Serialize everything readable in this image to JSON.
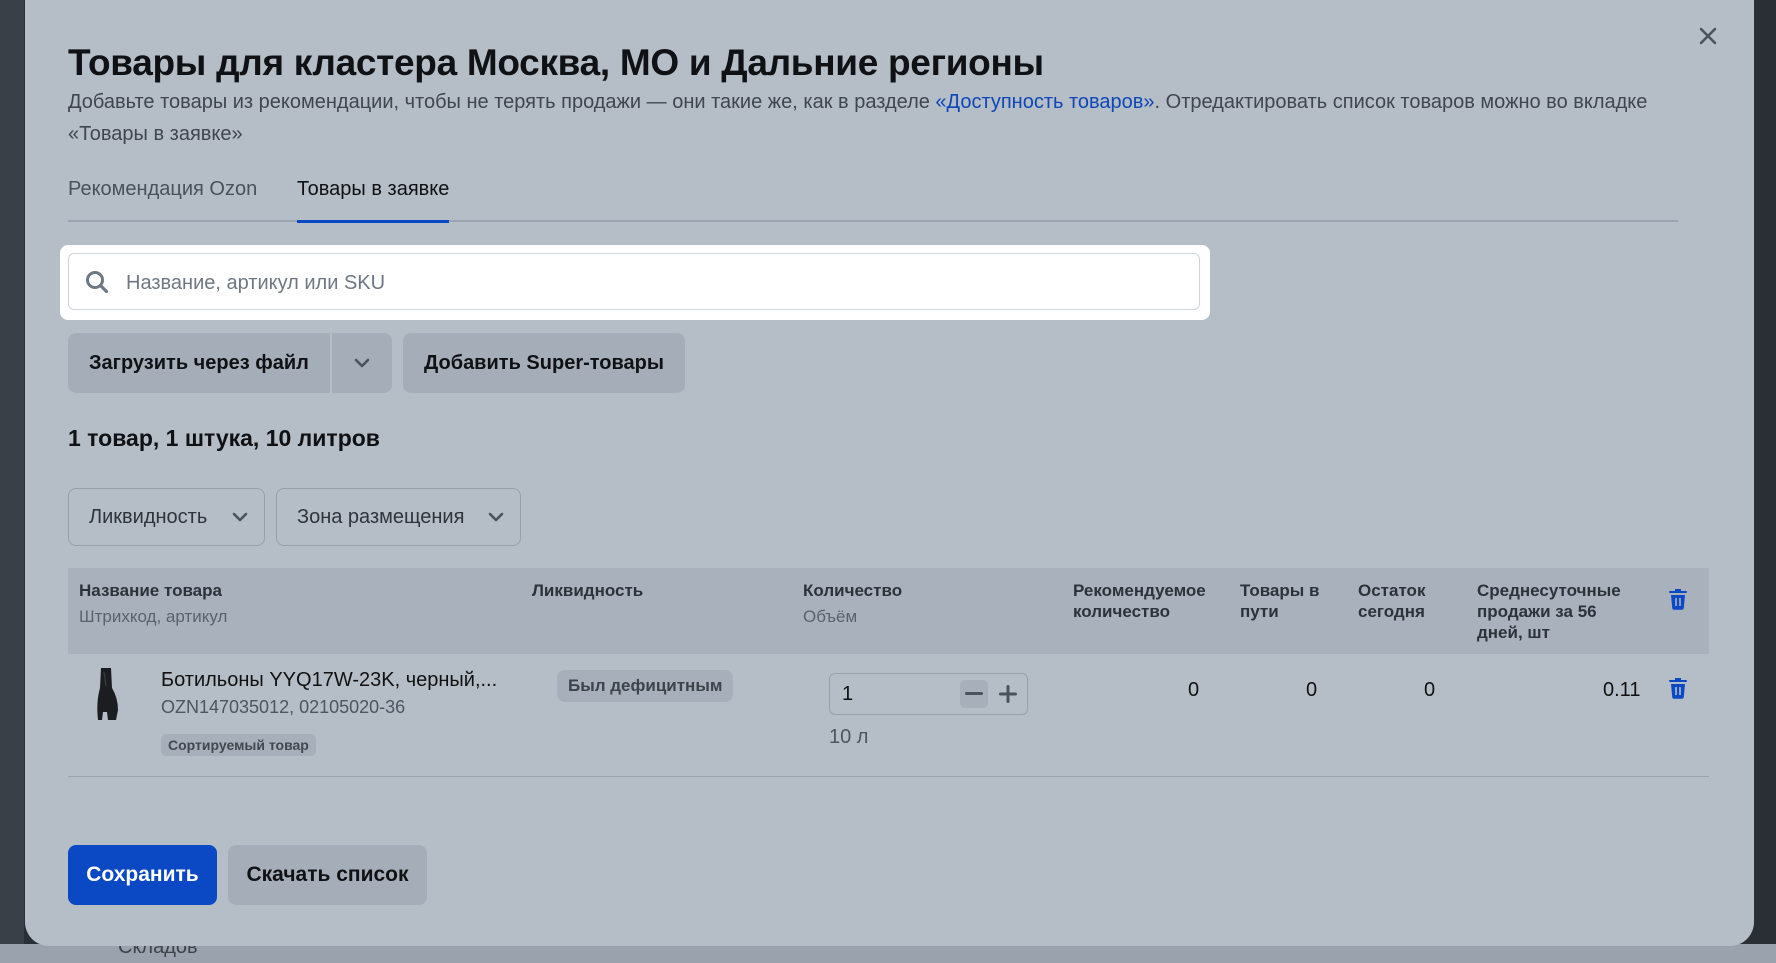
{
  "background": {
    "ghost_text": "Складов"
  },
  "modal": {
    "title": "Товары для кластера Москва, МО и Дальние регионы",
    "description_part1": "Добавьте товары из рекомендации, чтобы не терять продажи — они такие же, как в разделе ",
    "description_link": "«Доступность товаров»",
    "description_part2": ". Отредактировать список товаров можно во вкладке «Товары в заявке»",
    "close_icon": "close-icon"
  },
  "tabs": [
    {
      "label": "Рекомендация Ozon",
      "active": false
    },
    {
      "label": "Товары в заявке",
      "active": true
    }
  ],
  "search": {
    "placeholder": "Название, артикул или SKU",
    "value": "",
    "icon": "search-icon"
  },
  "actions": {
    "upload_label": "Загрузить через файл",
    "add_super_label": "Добавить Super-товары"
  },
  "summary": "1 товар, 1 штука, 10 литров",
  "filters": [
    {
      "label": "Ликвидность"
    },
    {
      "label": "Зона размещения"
    }
  ],
  "table": {
    "headers": {
      "name": "Название товара",
      "name_sub": "Штрихкод, артикул",
      "liquidity": "Ликвидность",
      "quantity": "Количество",
      "quantity_sub": "Объём",
      "recommended": "Рекомендуемое количество",
      "in_transit": "Товары в пути",
      "stock_today": "Остаток сегодня",
      "avg_sales": "Среднесуточные продажи",
      "avg_sales_period": "за 56 дней, шт"
    },
    "rows": [
      {
        "name": "Ботильоны YYQ17W-23K, черный,...",
        "codes": "OZN147035012, 02105020-36",
        "badge": "Сортируемый товар",
        "liquidity": "Был дефицитным",
        "quantity": "1",
        "volume": "10 л",
        "recommended": "0",
        "in_transit": "0",
        "stock_today": "0",
        "avg_sales": "0.11"
      }
    ]
  },
  "footer": {
    "save_label": "Сохранить",
    "download_label": "Скачать список"
  },
  "colors": {
    "accent": "#0b49c4",
    "link": "#0d47b8",
    "overlay_panel": "#b5bdc6"
  }
}
